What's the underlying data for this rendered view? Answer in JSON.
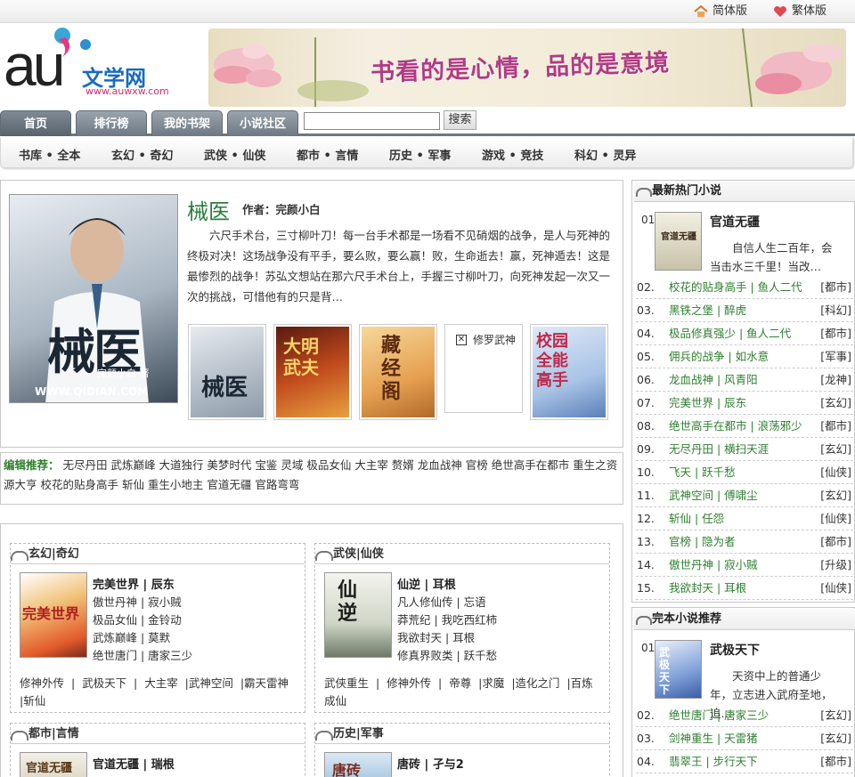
{
  "top": {
    "simplified": "简体版",
    "traditional": "繁体版"
  },
  "logo": {
    "au": "au",
    "name": "文学网",
    "url": "www.auwxw.com"
  },
  "banner": {
    "slogan": "书看的是心情，品的是意境"
  },
  "nav": {
    "tabs": [
      "首页",
      "排行榜",
      "我的书架",
      "小说社区"
    ],
    "search_button": "搜索",
    "search_value": ""
  },
  "subnav": [
    "书库 • 全本",
    "玄幻 • 奇幻",
    "武侠 • 仙侠",
    "都市 • 言情",
    "历史 • 军事",
    "游戏 • 竞技",
    "科幻 • 灵异"
  ],
  "feature": {
    "title": "械医",
    "author_label": "作者：完颜小白",
    "desc": "六尺手术台，三寸柳叶刀！每一台手术都是一场看不见硝烟的战争，是人与死神的终极对决！这场战争没有平手，要么败，要么赢！败，生命逝去！赢，死神遁去！这是最惨烈的战争！苏弘文想站在那六尺手术台上，手握三寸柳叶刀，向死神发起一次又一次的挑战，可惜他有的只是背…",
    "cover_title": "械医",
    "cover_author": "完颜小白 著",
    "cover_site": "WWW.QIDIAN.COM",
    "thumbs": [
      "械医",
      "大明武夫",
      "藏经阁",
      "修罗武神",
      "校园全能高手"
    ],
    "broken_label": "修罗武神"
  },
  "recommend": {
    "label": "编辑推荐：",
    "text": "无尽丹田 武炼巅峰 大道独行 美梦时代 宝鉴 灵域 极品女仙 大主宰 赘婿 龙血战神 官榜 绝世高手在都市 重生之资源大亨 校花的贴身高手 斩仙 重生小地主 官道无疆 官路弯弯"
  },
  "sections": [
    {
      "title": "玄幻|奇幻",
      "lead": "完美世界 | 辰东",
      "lines": [
        "傲世丹神 | 寂小贼",
        "极品女仙 | 金铃动",
        "武炼巅峰 | 莫默",
        "绝世唐门 | 唐家三少"
      ],
      "more": "修神外传  |  武极天下  |  大主宰  |武神空间  |霸天雷神  |斩仙",
      "cover": "完美世界"
    },
    {
      "title": "武侠|仙侠",
      "lead": "仙逆 | 耳根",
      "lines": [
        "凡人修仙传 | 忘语",
        "莽荒纪 | 我吃西红柿",
        "我欲封天 | 耳根",
        "修真界败类 | 跃千愁"
      ],
      "more": "武侠重生  |  修神外传  |  帝尊  |求魔  |造化之门  |百炼成仙",
      "cover": "仙逆"
    },
    {
      "title": "都市|言情",
      "lead": "官道无疆 | 瑞根",
      "cover": "官道无疆"
    },
    {
      "title": "历史|军事",
      "lead": "唐砖 | 孑与2",
      "cover": "唐砖"
    }
  ],
  "hot": {
    "title": "最新热门小说",
    "top": {
      "num": "01.",
      "name": "官道无疆",
      "desc": "自信人生二百年，会当击水三千里！当改…"
    },
    "items": [
      {
        "num": "02.",
        "name": "校花的贴身高手 | 鱼人二代",
        "cat": "[都市]"
      },
      {
        "num": "03.",
        "name": "黑铁之堡 | 醉虎",
        "cat": "[科幻]"
      },
      {
        "num": "04.",
        "name": "极品修真强少 | 鱼人二代",
        "cat": "[都市]"
      },
      {
        "num": "05.",
        "name": "佣兵的战争 | 如水意",
        "cat": "[军事]"
      },
      {
        "num": "06.",
        "name": "龙血战神 | 风青阳",
        "cat": "[龙神]"
      },
      {
        "num": "07.",
        "name": "完美世界 | 辰东",
        "cat": "[玄幻]"
      },
      {
        "num": "08.",
        "name": "绝世高手在都市 | 浪荡邪少",
        "cat": "[都市]"
      },
      {
        "num": "09.",
        "name": "无尽丹田 | 横扫天涯",
        "cat": "[玄幻]"
      },
      {
        "num": "10.",
        "name": "飞天 | 跃千愁",
        "cat": "[仙侠]"
      },
      {
        "num": "11.",
        "name": "武神空间 | 傅啸尘",
        "cat": "[玄幻]"
      },
      {
        "num": "12.",
        "name": "斩仙 | 任怨",
        "cat": "[仙侠]"
      },
      {
        "num": "13.",
        "name": "官榜 | 隐为者",
        "cat": "[都市]"
      },
      {
        "num": "14.",
        "name": "傲世丹神 | 寂小贼",
        "cat": "[升级]"
      },
      {
        "num": "15.",
        "name": "我欲封天 | 耳根",
        "cat": "[仙侠]"
      }
    ]
  },
  "complete": {
    "title": "完本小说推荐",
    "top": {
      "num": "01.",
      "name": "武极天下",
      "desc": "天资中上的普通少年，立志进入武府圣地，追…"
    },
    "items": [
      {
        "num": "02.",
        "name": "绝世唐门 | 唐家三少",
        "cat": "[玄幻]"
      },
      {
        "num": "03.",
        "name": "剑神重生 | 天雷猪",
        "cat": "[玄幻]"
      },
      {
        "num": "04.",
        "name": "翡翠王 | 步行天下",
        "cat": "[都市]"
      }
    ]
  }
}
